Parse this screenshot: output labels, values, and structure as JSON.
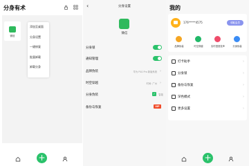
{
  "screen1": {
    "title": "分身有术",
    "grid": {
      "app_label": "微信"
    },
    "context_menu": [
      "添加至桌面",
      "分身设置",
      "一键修复",
      "批量卸载",
      "卸载分身"
    ],
    "nav": {
      "fab_label": "+"
    }
  },
  "screen2": {
    "back": "‹",
    "title": "分身设置",
    "app_name": "微信",
    "rows": [
      {
        "label": "分身锁"
      },
      {
        "label": "通知管理"
      },
      {
        "label": "品牌伪装",
        "value": "华为 P40 Pro 新版系统"
      },
      {
        "label": "时空穿越",
        "value": "时间: 广州"
      },
      {
        "label": "分身伪装",
        "check_label": "智能"
      },
      {
        "label": "备份与恢复",
        "badge": "VIP"
      }
    ]
  },
  "screen3": {
    "title": "我的",
    "user_id": "176*****4575",
    "vip_button": "领取会员",
    "quick_actions": [
      {
        "label": "品牌伪装",
        "color": "#f5a623"
      },
      {
        "label": "时空穿越",
        "color": "#21b868"
      },
      {
        "label": "实时语音变声",
        "color": "#ef4b6a"
      },
      {
        "label": "分身伪装",
        "color": "#3a8cf5"
      }
    ],
    "menu": [
      {
        "label": "打卡助手"
      },
      {
        "label": "分身锁"
      },
      {
        "label": "备份与恢复"
      },
      {
        "label": "深色模式"
      },
      {
        "label": "更多设置"
      }
    ]
  }
}
